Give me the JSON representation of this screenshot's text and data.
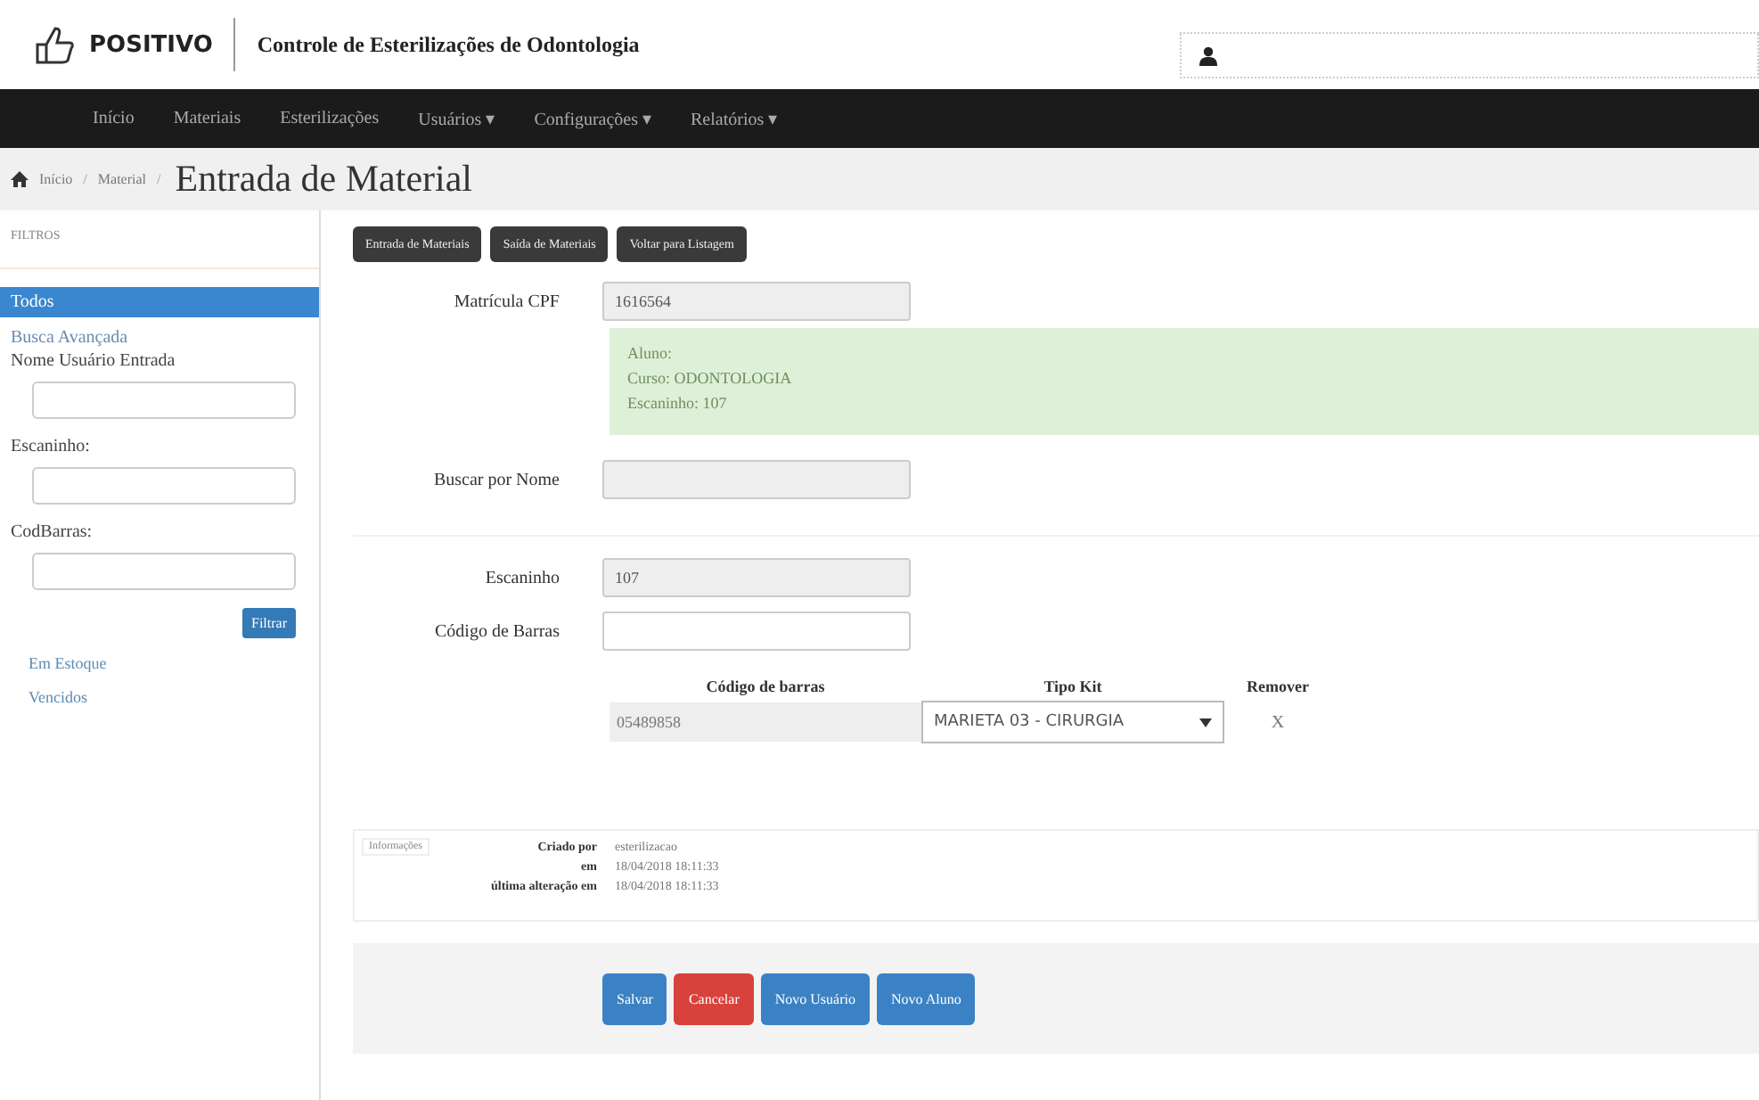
{
  "header": {
    "logo": "POSITIVO",
    "title": "Controle de Esterilizações de Odontologia"
  },
  "nav": [
    "Início",
    "Materiais",
    "Esterilizações",
    "Usuários ▾",
    "Configurações ▾",
    "Relatórios ▾"
  ],
  "breadcrumb": {
    "items": [
      "Início",
      "Material"
    ],
    "separator": "/",
    "title": "Entrada de Material"
  },
  "sidebar": {
    "heading": "FILTROS",
    "items": [
      {
        "label": "Todos",
        "selected": true
      }
    ],
    "advanced": "Busca Avançada",
    "fields": [
      {
        "label": "Nome Usuário Entrada"
      },
      {
        "label": "Escaninho:"
      },
      {
        "label": "CodBarras:"
      }
    ],
    "filter_button": "Filtrar",
    "links": [
      {
        "label": "Em Estoque",
        "selected": false
      },
      {
        "label": "Vencidos",
        "selected": false
      }
    ]
  },
  "toolbar": [
    "Entrada de Materiais",
    "Saída de Materiais",
    "Voltar para Listagem"
  ],
  "form": {
    "matricula": {
      "label": "Matrícula CPF",
      "value": "1616564",
      "disabled": true
    },
    "alert": [
      "Aluno:",
      "Curso: ODONTOLOGIA",
      "Escaninho: 107"
    ],
    "buscar": {
      "label": "Buscar por Nome",
      "disabled": true
    },
    "escaninho": {
      "label": "Escaninho",
      "value": "107",
      "disabled": true
    },
    "codigo": {
      "label": "Código de Barras",
      "disabled": false
    }
  },
  "table": {
    "columns": [
      "Código de barras",
      "Tipo Kit",
      "Remover"
    ],
    "rows": [
      {
        "barcode": "05489858",
        "kit": "MARIETA 03 - CIRURGIA",
        "remove": "X"
      }
    ]
  },
  "info": {
    "legend": "Informações",
    "rows": [
      {
        "label": "Criado por",
        "value": "esterilizacao"
      },
      {
        "label": "em",
        "value": "18/04/2018 18:11:33"
      },
      {
        "label": "última alteração em",
        "value": "18/04/2018 18:11:33"
      }
    ]
  },
  "actions": [
    {
      "label": "Salvar",
      "kind": "primary"
    },
    {
      "label": "Cancelar",
      "kind": "danger"
    },
    {
      "label": "Novo Usuário",
      "kind": "primary"
    },
    {
      "label": "Novo Aluno",
      "kind": "primary"
    }
  ]
}
